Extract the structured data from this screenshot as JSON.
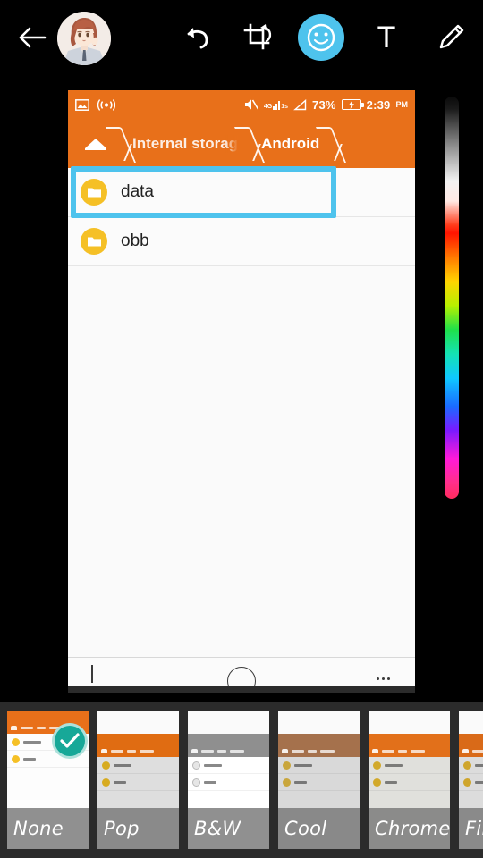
{
  "toolbar": {
    "back_label": "back-arrow",
    "avatar_label": "user-avatar",
    "undo_label": "undo",
    "crop_label": "crop-rotate",
    "sticker_label": "sticker",
    "text_label": "T",
    "draw_label": "draw",
    "active_tool": "sticker",
    "active_color": "#4ec3ed"
  },
  "canvas": {
    "annotation": {
      "type": "rectangle",
      "color": "#4ec3ed",
      "target": "data"
    },
    "status_bar": {
      "bg_color": "#e8701a",
      "screenshot_icon": "image-icon",
      "hotspot_icon": "hotspot-icon",
      "mute_icon": "volume-mute-icon",
      "network_type": "4G",
      "network_suffix": "1s",
      "battery_percent": "73%",
      "battery_state": "charging",
      "time": "2:39",
      "meridiem": "PM"
    },
    "breadcrumb": {
      "home_icon": "home-icon",
      "items": [
        "Internal storag",
        "Android"
      ]
    },
    "files": [
      {
        "name": "data",
        "type": "folder",
        "selected": true
      },
      {
        "name": "obb",
        "type": "folder",
        "selected": false
      }
    ],
    "nav_bar": {
      "back": "nav-back",
      "home": "nav-home",
      "recents": "nav-recents"
    }
  },
  "color_slider": {
    "name": "color-picker-slider",
    "stops": [
      "#000000",
      "#ffffff",
      "#ff1400",
      "#ff7a00",
      "#ffd400",
      "#1fe04a",
      "#0fc8ff",
      "#1a6bff",
      "#ff1ad9",
      "#ff2b5e"
    ]
  },
  "filters": {
    "selected": "None",
    "check_color": "#17a898",
    "items": [
      {
        "label": "None",
        "bar": "#e8701a",
        "body": "#fdfdfd",
        "dot": "#f5c026",
        "text": "#2a2a2a",
        "selected": true
      },
      {
        "label": "Pop",
        "bar": "#e06c12",
        "body": "#dedede",
        "dot": "#d7ab20",
        "text": "#3a3a3a",
        "selected": false
      },
      {
        "label": "B&W",
        "bar": "#8f8f8f",
        "body": "#ffffff",
        "dot": "#e6e6e6",
        "text": "#4a4a4a",
        "selected": false
      },
      {
        "label": "Cool",
        "bar": "#a5714c",
        "body": "#d9d9d9",
        "dot": "#c9a63c",
        "text": "#3f3f3f",
        "selected": false
      },
      {
        "label": "Chrome",
        "bar": "#e2701a",
        "body": "#e0e0dc",
        "dot": "#d2a92a",
        "text": "#3a3a3a",
        "selected": false
      },
      {
        "label": "Fil",
        "bar": "#d96a18",
        "body": "#dcdcdc",
        "dot": "#cfa52b",
        "text": "#3a3a3a",
        "selected": false
      }
    ]
  }
}
